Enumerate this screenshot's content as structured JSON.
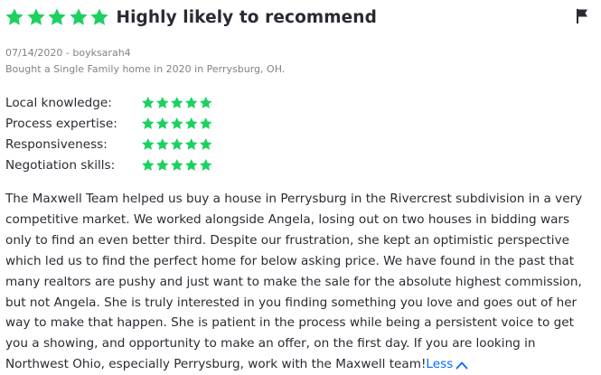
{
  "header": {
    "title": "Highly likely to recommend",
    "overall_rating": 5,
    "star_color": "#1cd160",
    "flag_icon": "flag-icon"
  },
  "meta": {
    "date_author": "07/14/2020 - boyksarah4",
    "bought": "Bought a Single Family home in 2020 in Perrysburg, OH."
  },
  "ratings": [
    {
      "label": "Local knowledge:",
      "stars": 5
    },
    {
      "label": "Process expertise:",
      "stars": 5
    },
    {
      "label": "Responsiveness:",
      "stars": 5
    },
    {
      "label": "Negotiation skills:",
      "stars": 5
    }
  ],
  "review": {
    "lines": [
      "The Maxwell Team helped us buy a house in Perrysburg in the Rivercrest subdivision in a very",
      "competitive market. We worked alongside Angela, losing out on two houses in bidding wars",
      "only to find an even better third.  Despite our frustration, she kept an optimistic perspective",
      "which led us to find the perfect home for below asking price. We have found in the past that",
      "many realtors are pushy and just want to make the sale for the absolute highest commission,",
      "but not Angela. She is truly interested in you finding something you love and goes out of her",
      "way to make that happen. She is patient in the process while being a persistent voice to get",
      "you a showing, and opportunity to make an offer, on the first day. If you are looking in",
      "Northwest Ohio, especially Perrysburg, work with the Maxwell team!"
    ],
    "less_label": "Less",
    "less_icon": "chevron-up-icon",
    "link_color": "#006aff"
  }
}
